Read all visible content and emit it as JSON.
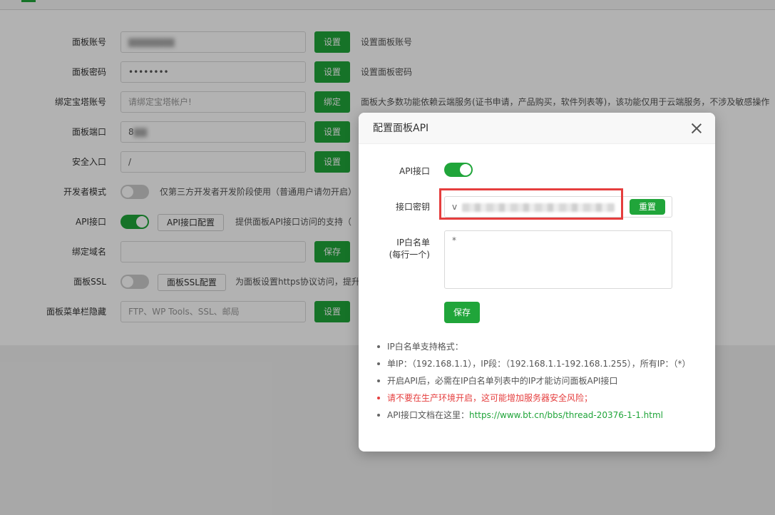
{
  "settings": {
    "rows": [
      {
        "label": "面板账号",
        "value": "",
        "button": "设置",
        "hint": "设置面板账号"
      },
      {
        "label": "面板密码",
        "value": "••••••••",
        "button": "设置",
        "hint": "设置面板密码"
      },
      {
        "label": "绑定宝塔账号",
        "placeholder": "请绑定宝塔帐户!",
        "button": "绑定",
        "hint": "面板大多数功能依赖云端服务(证书申请，产品购买，软件列表等)，该功能仅用于云端服务，不涉及敏感操作"
      },
      {
        "label": "面板端口",
        "value": "8",
        "button": "设置"
      },
      {
        "label": "安全入口",
        "value": "/",
        "button": "设置"
      },
      {
        "label": "开发者模式",
        "toggle": false,
        "hint": "仅第三方开发者开发阶段使用（普通用户请勿开启）"
      },
      {
        "label": "API接口",
        "toggle": true,
        "config_button": "API接口配置",
        "hint": "提供面板API接口访问的支持（"
      },
      {
        "label": "绑定域名",
        "value": "",
        "button": "保存"
      },
      {
        "label": "面板SSL",
        "toggle": false,
        "config_button": "面板SSL配置",
        "hint": "为面板设置https协议访问，提升"
      },
      {
        "label": "面板菜单栏隐藏",
        "placeholder": "FTP、WP Tools、SSL、邮局",
        "button": "设置"
      }
    ]
  },
  "modal": {
    "title": "配置面板API",
    "api_label": "API接口",
    "api_enabled": true,
    "key_label": "接口密钥",
    "key_value": "v",
    "reset_label": "重置",
    "ip_label_line1": "IP白名单",
    "ip_label_line2": "(每行一个)",
    "ip_value": "*",
    "save_label": "保存",
    "notes": [
      "IP白名单支持格式：",
      "单IP：（192.168.1.1），IP段：（192.168.1.1-192.168.1.255），所有IP：（*）",
      "开启API后，必需在IP白名单列表中的IP才能访问面板API接口",
      "请不要在生产环境开启，这可能增加服务器安全风险；"
    ],
    "doc_prefix": "API接口文档在这里：",
    "doc_link": "https://www.bt.cn/bbs/thread-20376-1-1.html"
  },
  "colors": {
    "accent": "#20a53a",
    "danger": "#e53e3e"
  }
}
